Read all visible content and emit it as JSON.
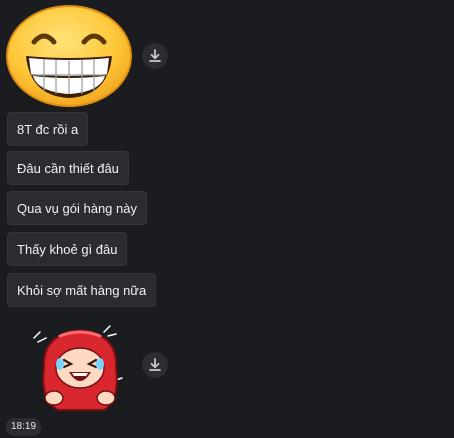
{
  "messages": [
    {
      "text": "8T đc rồi a"
    },
    {
      "text": "Đâu cần thiết đâu"
    },
    {
      "text": "Qua vụ gói hàng này"
    },
    {
      "text": "Thấy khoẻ gì đâu"
    },
    {
      "text": "Khỏi sợ mất hàng nữa"
    }
  ],
  "timestamp": "18:19",
  "colors": {
    "background": "#1b1c20",
    "bubble": "#2b2c31",
    "text": "#f2f2f2",
    "emoji_yellow": "#ffc83a",
    "sticker_red": "#d8282e"
  },
  "icons": {
    "sticker_1": "grinning-face-sticker",
    "sticker_2": "laughing-red-hood-sticker",
    "download": "download-icon"
  }
}
